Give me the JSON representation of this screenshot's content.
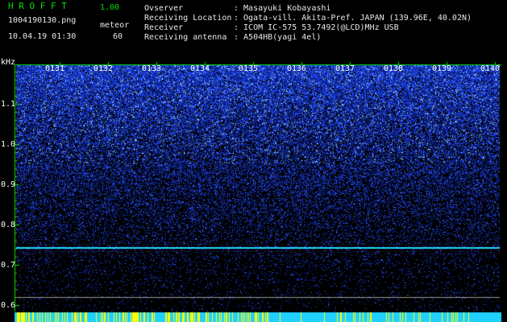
{
  "header": {
    "app_name": "H R O F F T",
    "version": "1.00",
    "file_name": "1004190130.png",
    "timestamp": "10.04.19 01:30",
    "meteor_label": "meteor",
    "meteor_count": "60"
  },
  "info": {
    "observer_label": "Ovserver",
    "observer_value": ": Masayuki Kobayashi",
    "location_label": "Receiving Location",
    "location_value": ": Ogata-vill. Akita-Pref. JAPAN (139.96E, 40.02N)",
    "receiver_label": "Receiver",
    "receiver_value": ": ICOM IC-575 53.7492(@LCD)MHz USB",
    "antenna_label": "Receiving antenna",
    "antenna_value": ": A504HB(yagi 4el)"
  },
  "spectrogram": {
    "unit": "kHz",
    "minutes": [
      "0131",
      "0132",
      "0133",
      "0134",
      "0135",
      "0136",
      "0137",
      "0138",
      "0139",
      "0140"
    ],
    "y_ticks": [
      "1.1",
      "1.0",
      "0.9",
      "0.8",
      "0.7",
      "0.6"
    ],
    "ylim": [
      0.6,
      1.2
    ],
    "signal_line_khz": 0.745,
    "reference_line_khz": 0.62,
    "colors": {
      "background": "#000000",
      "noise": "#1a2cff",
      "bright": "#9fe8ff",
      "signal": "#28d8ff",
      "label": "#00e000",
      "bottom_bar": "#20d0ff",
      "bottom_ticks": "#ffff00"
    }
  }
}
